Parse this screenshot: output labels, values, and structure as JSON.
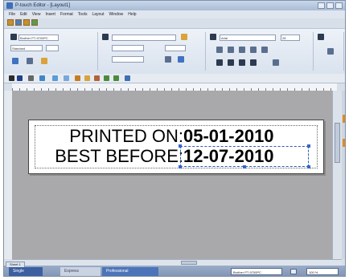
{
  "window": {
    "title": "P-touch Editor - [Layout1]"
  },
  "menu": [
    "File",
    "Edit",
    "View",
    "Insert",
    "Format",
    "Tools",
    "Layout",
    "Window",
    "Help"
  ],
  "ribbon": {
    "printer": "Brother PT-9700PC",
    "media": "Standard",
    "font": "Arial",
    "font_size": "28"
  },
  "label": {
    "printed_label": "PRINTED ON:",
    "printed_date": "05-01-2010",
    "best_label": "BEST BEFORE:",
    "best_date": "12-07-2010"
  },
  "statusbar": {
    "sheet_tab": "Sheet 1",
    "modes": [
      "Single",
      "Express",
      "Professional"
    ],
    "printer_select": "Brother PT-9700PC",
    "zoom": "100 %"
  },
  "colors": {
    "workspace": "#a9a9ab",
    "statusbar": "#7d93b4",
    "selection": "#2c5bb8"
  }
}
